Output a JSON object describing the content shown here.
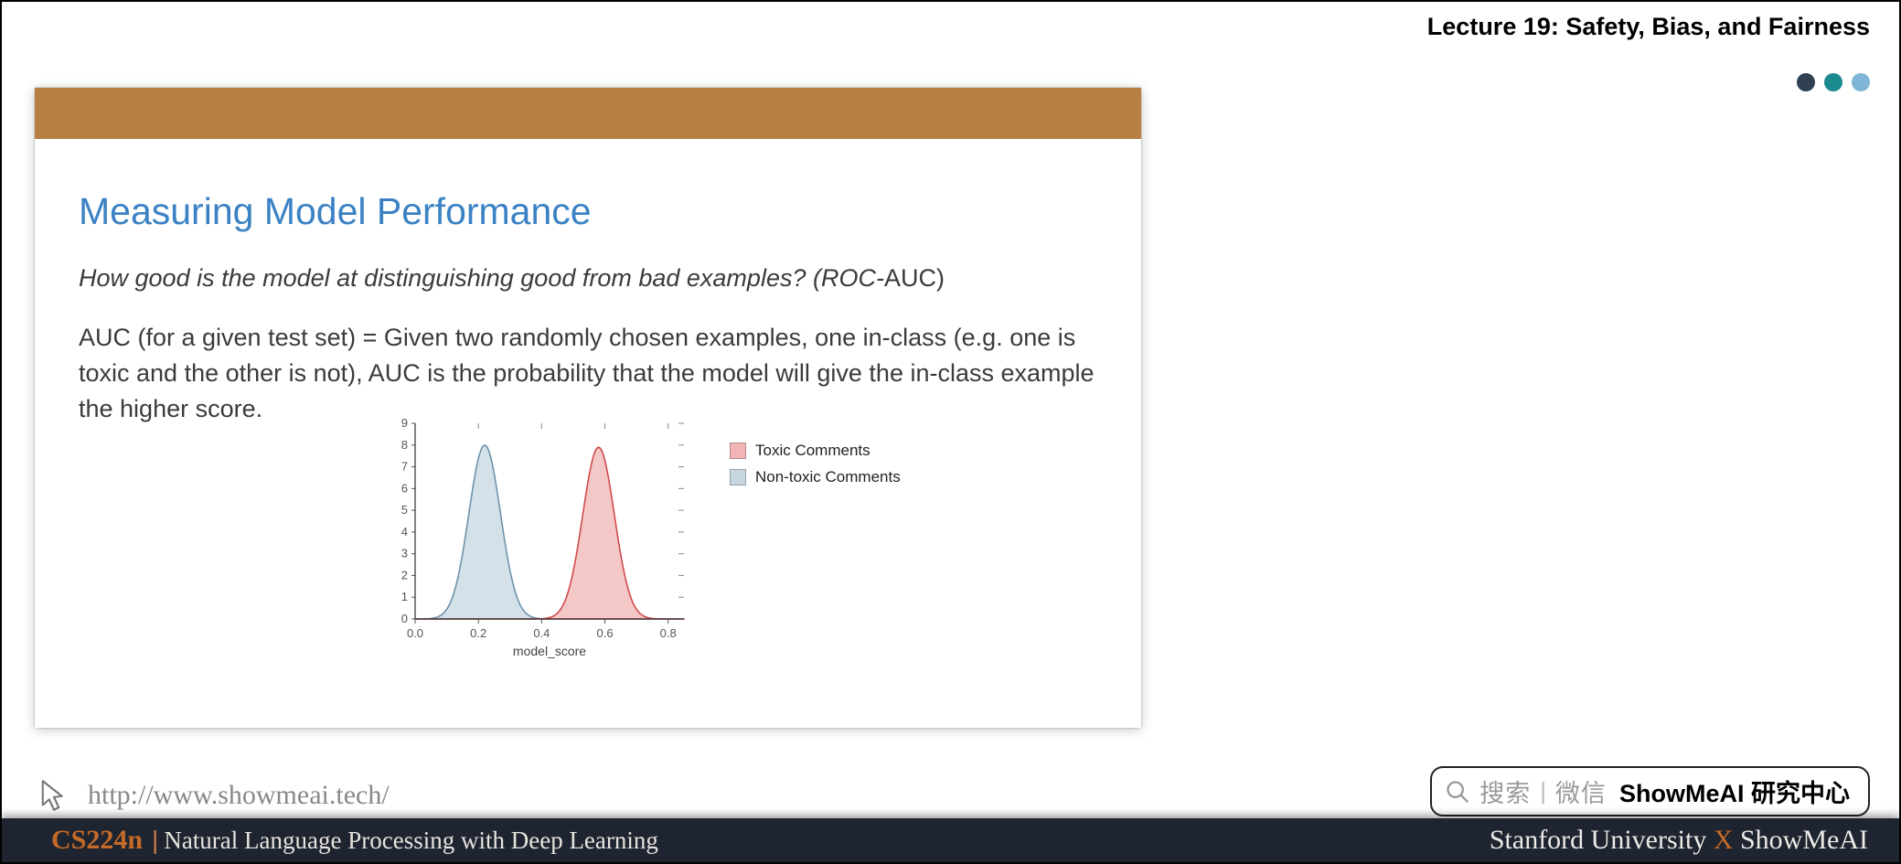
{
  "header": {
    "lecture_title": "Lecture 19: Safety, Bias, and Fairness"
  },
  "slide": {
    "title": "Measuring Model Performance",
    "subtitle_prefix": "How good is the model at distinguishing good from bad examples? (ROC-",
    "subtitle_suffix": "AUC)",
    "description": "AUC (for a given test set) = Given two randomly chosen examples, one in-class (e.g. one is toxic and the other is not), AUC is the probability that the model will give the in-class example the higher score."
  },
  "chart_data": {
    "type": "area",
    "xlabel": "model_score",
    "ylabel": "",
    "x_ticks": [
      0.0,
      0.2,
      0.4,
      0.6,
      0.8
    ],
    "y_ticks": [
      0,
      1,
      2,
      3,
      4,
      5,
      6,
      7,
      8,
      9
    ],
    "ylim": [
      0,
      9
    ],
    "xlim": [
      0.0,
      0.85
    ],
    "series": [
      {
        "name": "Toxic Comments",
        "color": "#f2b5b5",
        "stroke": "#cf4b4b",
        "mu": 0.58,
        "sigma": 0.05,
        "peak": 7.9
      },
      {
        "name": "Non-toxic Comments",
        "color": "#c7d7e0",
        "stroke": "#6e93ac",
        "mu": 0.22,
        "sigma": 0.05,
        "peak": 8.0
      }
    ],
    "legend": [
      {
        "label": "Toxic Comments",
        "swatch": "#f2b5b5"
      },
      {
        "label": "Non-toxic Comments",
        "swatch": "#c7d7e0"
      }
    ]
  },
  "url": "http://www.showmeai.tech/",
  "search": {
    "prefix": "搜索",
    "divider": "|",
    "mid": "微信",
    "bold": "ShowMeAI 研究中心"
  },
  "footer": {
    "course": "CS224n",
    "subtitle": "Natural Language Processing with Deep Learning",
    "right_prefix": "Stanford University ",
    "right_x": "X",
    "right_suffix": " ShowMeAI"
  }
}
